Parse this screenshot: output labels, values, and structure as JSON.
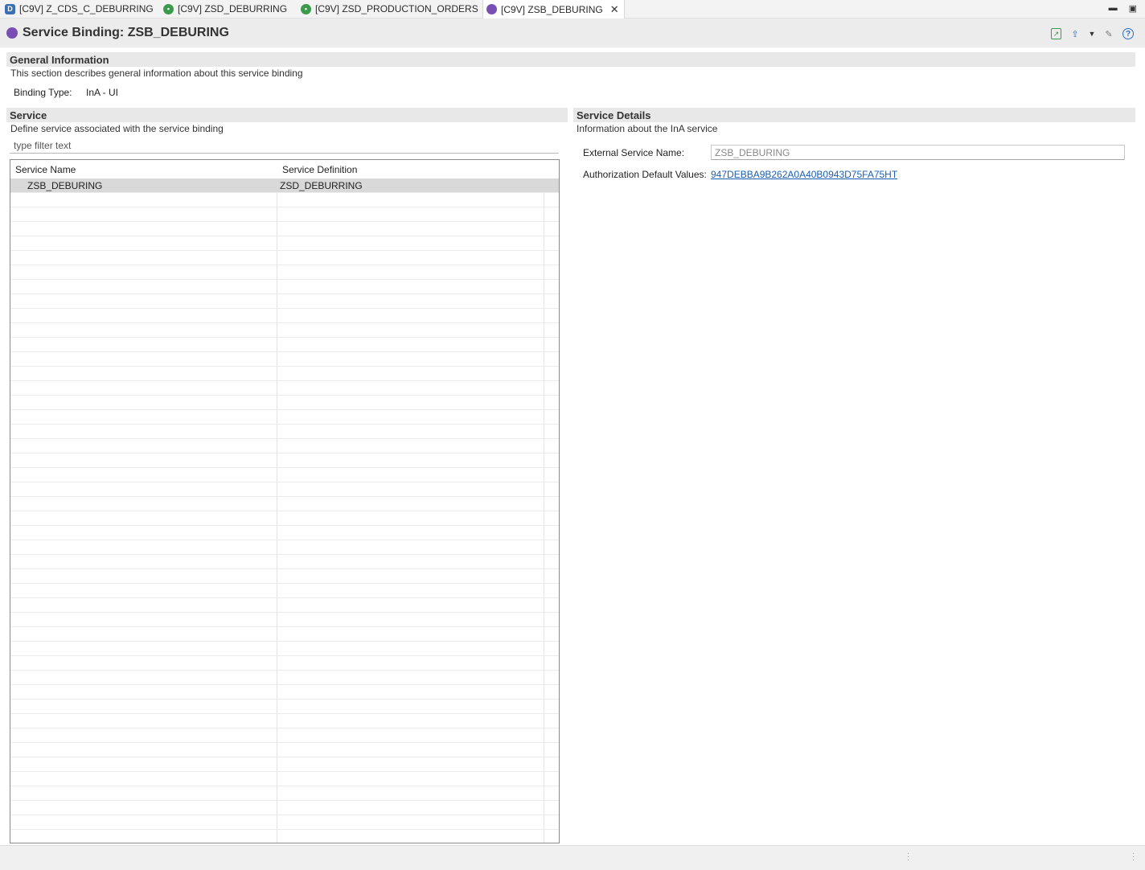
{
  "tabs": [
    {
      "label": "[C9V] Z_CDS_C_DEBURRING",
      "icon": "ddl-icon"
    },
    {
      "label": "[C9V] ZSD_DEBURRING",
      "icon": "service-definition-icon"
    },
    {
      "label": "[C9V] ZSD_PRODUCTION_ORDERS",
      "icon": "service-definition-icon"
    },
    {
      "label": "[C9V] ZSB_DEBURING",
      "icon": "service-binding-icon",
      "active": true
    }
  ],
  "editor": {
    "title": "Service Binding: ZSB_DEBURING"
  },
  "general": {
    "heading": "General Information",
    "description": "This section describes general information about this service binding",
    "binding_type_label": "Binding Type:",
    "binding_type_value": "InA - UI"
  },
  "service": {
    "heading": "Service",
    "description": "Define service associated with the service binding",
    "filter_placeholder": "type filter text",
    "columns": [
      "Service Name",
      "Service Definition"
    ],
    "rows": [
      {
        "name": "ZSB_DEBURING",
        "definition": "ZSD_DEBURRING",
        "selected": true
      }
    ]
  },
  "details": {
    "heading": "Service Details",
    "description": "Information about the InA service",
    "external_name_label": "External Service Name:",
    "external_name_value": "ZSB_DEBURING",
    "auth_label": "Authorization Default Values:",
    "auth_value": "947DEBBA9B262A0A40B0943D75FA75HT"
  },
  "colors": {
    "section_header_bg": "#e8e8e8",
    "selected_row_bg": "#d9d9d9",
    "link": "#1a5fb4",
    "binding_icon": "#7a4fb3",
    "service_def_icon": "#3c9a4c"
  }
}
